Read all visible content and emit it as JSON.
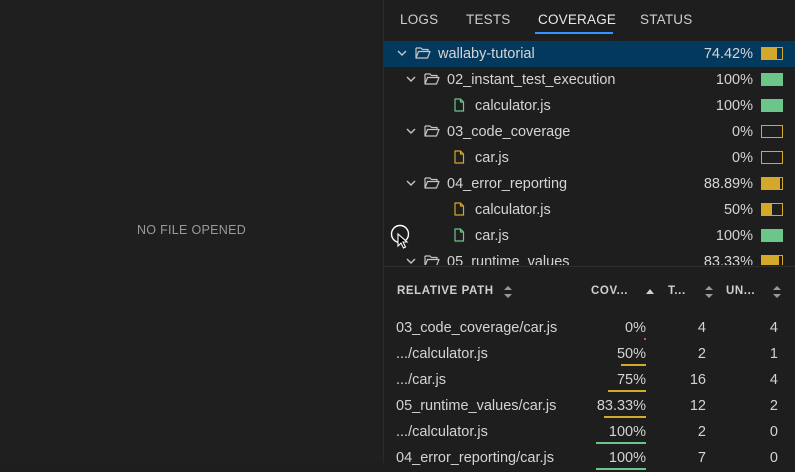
{
  "editor": {
    "placeholder": "NO FILE OPENED"
  },
  "tabs": [
    {
      "label": "LOGS"
    },
    {
      "label": "TESTS"
    },
    {
      "label": "COVERAGE",
      "active": true
    },
    {
      "label": "STATUS"
    }
  ],
  "tree": [
    {
      "name": "wallaby-tutorial",
      "type": "folder",
      "pct": "74.42%",
      "coverage": 0.7442,
      "status": "partial",
      "selected": true
    },
    {
      "name": "02_instant_test_execution",
      "type": "folder",
      "pct": "100%",
      "coverage": 1.0,
      "status": "full"
    },
    {
      "name": "calculator.js",
      "type": "file",
      "pct": "100%",
      "coverage": 1.0,
      "status": "full"
    },
    {
      "name": "03_code_coverage",
      "type": "folder",
      "pct": "0%",
      "coverage": 0,
      "status": "none"
    },
    {
      "name": "car.js",
      "type": "file",
      "pct": "0%",
      "coverage": 0,
      "status": "none"
    },
    {
      "name": "04_error_reporting",
      "type": "folder",
      "pct": "88.89%",
      "coverage": 0.8889,
      "status": "partial"
    },
    {
      "name": "calculator.js",
      "type": "file",
      "pct": "50%",
      "coverage": 0.5,
      "status": "partial"
    },
    {
      "name": "car.js",
      "type": "file",
      "pct": "100%",
      "coverage": 1.0,
      "status": "full"
    },
    {
      "name": "05_runtime_values",
      "type": "folder",
      "pct": "83.33%",
      "coverage": 0.8333,
      "status": "partial"
    }
  ],
  "table": {
    "headers": {
      "path": "RELATIVE PATH",
      "coverage": "COV...",
      "tests": "T...",
      "uncovered": "UN..."
    },
    "rows": [
      {
        "path": "03_code_coverage/car.js",
        "coverage": "0%",
        "coverage_value": 0,
        "tests": "4",
        "uncovered": "4"
      },
      {
        "path": ".../calculator.js",
        "coverage": "50%",
        "coverage_value": 0.5,
        "tests": "2",
        "uncovered": "1"
      },
      {
        "path": ".../car.js",
        "coverage": "75%",
        "coverage_value": 0.75,
        "tests": "16",
        "uncovered": "4"
      },
      {
        "path": "05_runtime_values/car.js",
        "coverage": "83.33%",
        "coverage_value": 0.8333,
        "tests": "12",
        "uncovered": "2"
      },
      {
        "path": ".../calculator.js",
        "coverage": "100%",
        "coverage_value": 1.0,
        "tests": "2",
        "uncovered": "0"
      },
      {
        "path": "04_error_reporting/car.js",
        "coverage": "100%",
        "coverage_value": 1.0,
        "tests": "7",
        "uncovered": "0"
      }
    ]
  },
  "colors": {
    "full": "#6cc68c",
    "partial": "#d4a82a",
    "empty_border": "#d4a82a",
    "accent": "#3794ff",
    "selected_row": "#04395e"
  }
}
